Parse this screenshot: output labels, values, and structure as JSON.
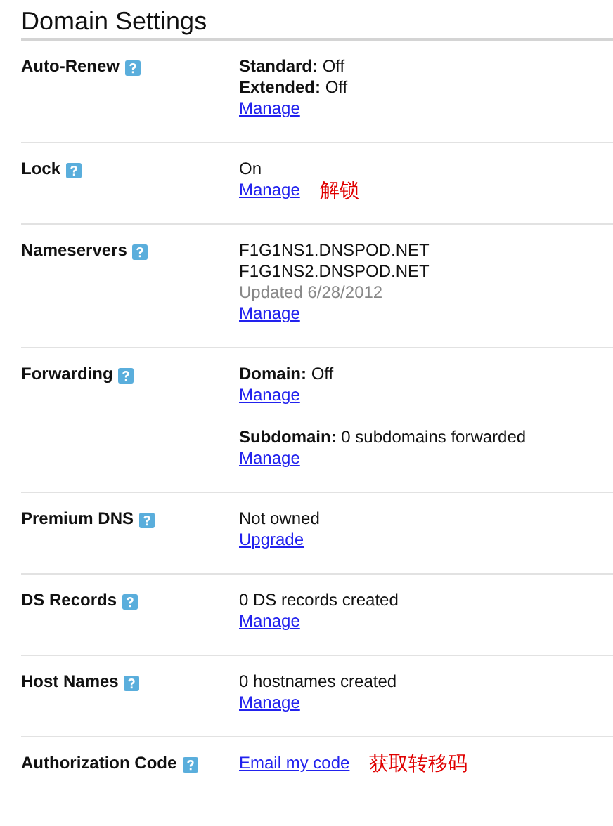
{
  "title": "Domain Settings",
  "settings": [
    {
      "label": "Auto-Renew",
      "groups": [
        [
          {
            "kind": "text",
            "text": "**Standard:** Off"
          },
          {
            "kind": "text",
            "text": "**Extended:** Off"
          },
          {
            "kind": "link",
            "text": "Manage"
          }
        ]
      ]
    },
    {
      "label": "Lock",
      "groups": [
        [
          {
            "kind": "text",
            "text": "On"
          },
          {
            "kind": "link",
            "text": "Manage",
            "note": "解锁"
          }
        ]
      ]
    },
    {
      "label": "Nameservers",
      "groups": [
        [
          {
            "kind": "text",
            "text": "F1G1NS1.DNSPOD.NET"
          },
          {
            "kind": "text",
            "text": "F1G1NS2.DNSPOD.NET"
          },
          {
            "kind": "muted",
            "text": "Updated 6/28/2012"
          },
          {
            "kind": "link",
            "text": "Manage"
          }
        ]
      ]
    },
    {
      "label": "Forwarding",
      "groups": [
        [
          {
            "kind": "text",
            "text": "**Domain:** Off"
          },
          {
            "kind": "link",
            "text": "Manage"
          }
        ],
        [
          {
            "kind": "text",
            "text": "**Subdomain:** 0 subdomains forwarded"
          },
          {
            "kind": "link",
            "text": "Manage"
          }
        ]
      ]
    },
    {
      "label": "Premium DNS",
      "groups": [
        [
          {
            "kind": "text",
            "text": "Not owned"
          },
          {
            "kind": "link",
            "text": "Upgrade"
          }
        ]
      ]
    },
    {
      "label": "DS Records",
      "groups": [
        [
          {
            "kind": "text",
            "text": "0 DS records created"
          },
          {
            "kind": "link",
            "text": "Manage"
          }
        ]
      ]
    },
    {
      "label": "Host Names",
      "groups": [
        [
          {
            "kind": "text",
            "text": "0 hostnames created"
          },
          {
            "kind": "link",
            "text": "Manage"
          }
        ]
      ]
    },
    {
      "label": "Authorization Code",
      "groups": [
        [
          {
            "kind": "link",
            "text": "Email my code",
            "note": "获取转移码"
          }
        ]
      ]
    }
  ]
}
